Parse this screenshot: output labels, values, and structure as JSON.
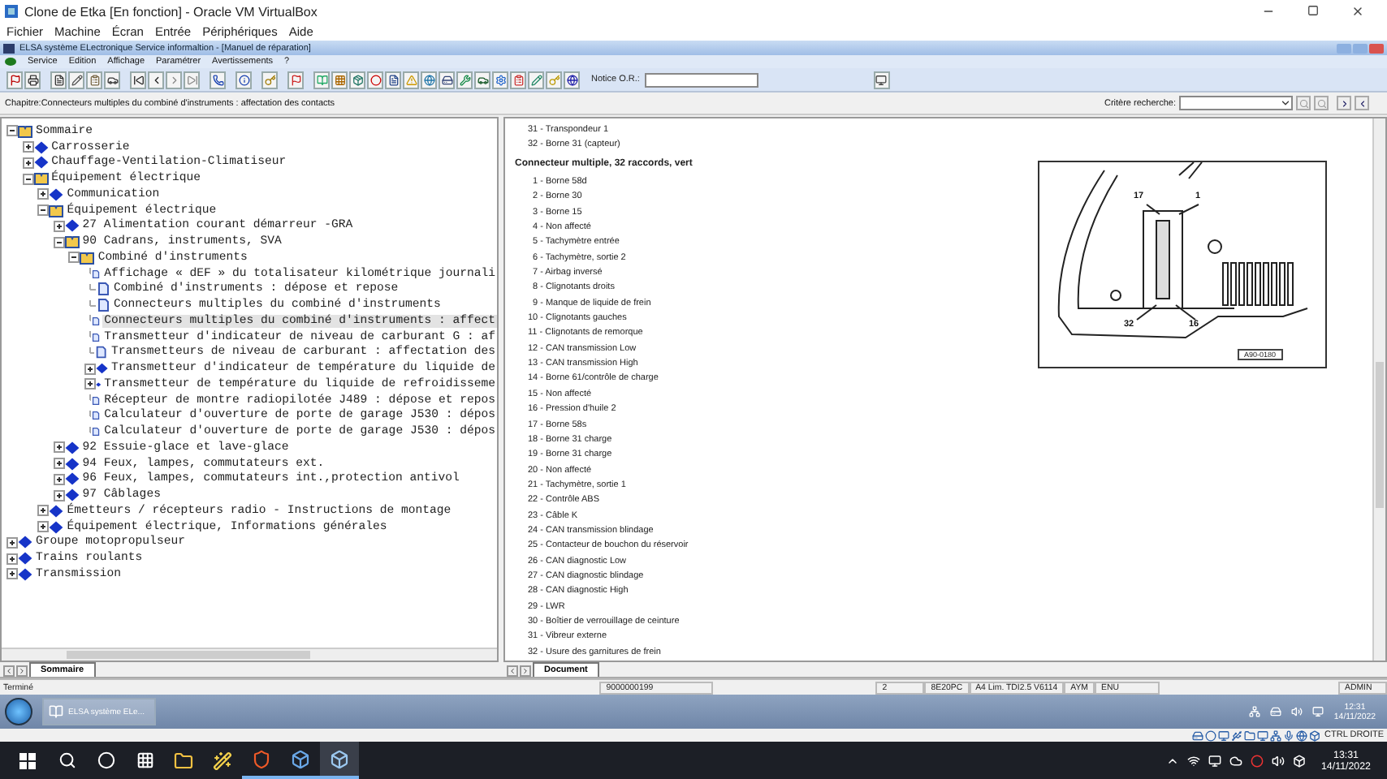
{
  "vbox": {
    "title": "Clone de Etka [En fonction] - Oracle VM VirtualBox",
    "menu": [
      "Fichier",
      "Machine",
      "Écran",
      "Entrée",
      "Périphériques",
      "Aide"
    ],
    "host_key": "CTRL DROITE"
  },
  "app": {
    "title": "ELSA système ELectronique Service informaltion - [Manuel de réparation]",
    "menu": [
      "Service",
      "Edition",
      "Affichage",
      "Paramétrer",
      "Avertissements",
      "?"
    ],
    "notice_label": "Notice O.R.:",
    "chapter": "Chapitre:Connecteurs multiples du combiné d'instruments : affectation des contacts",
    "search_label": "Critère recherche:"
  },
  "tree": {
    "items": [
      {
        "label": "Sommaire",
        "kind": "folder",
        "expanded": true,
        "selected": false,
        "children": [
          {
            "label": "Carrosserie",
            "kind": "topic",
            "expanded": false,
            "selected": false
          },
          {
            "label": "Chauffage-Ventilation-Climatiseur",
            "kind": "topic",
            "expanded": false,
            "selected": false
          },
          {
            "label": "Équipement électrique",
            "kind": "folder",
            "expanded": true,
            "selected": false,
            "children": [
              {
                "label": "Communication",
                "kind": "topic",
                "expanded": false,
                "selected": false
              },
              {
                "label": "Équipement électrique",
                "kind": "folder",
                "expanded": true,
                "selected": false,
                "children": [
                  {
                    "label": "27 Alimentation courant démarreur -GRA",
                    "kind": "topic",
                    "expanded": false,
                    "selected": false
                  },
                  {
                    "label": "90 Cadrans, instruments, SVA",
                    "kind": "folder",
                    "expanded": true,
                    "selected": false,
                    "children": [
                      {
                        "label": "Combiné d'instruments",
                        "kind": "folder",
                        "expanded": true,
                        "selected": false,
                        "children": [
                          {
                            "label": "Affichage « dEF » du totalisateur kilométrique journali",
                            "kind": "page",
                            "selected": false
                          },
                          {
                            "label": "Combiné d'instruments : dépose et repose",
                            "kind": "page",
                            "selected": false
                          },
                          {
                            "label": "Connecteurs multiples du combiné d'instruments",
                            "kind": "page",
                            "selected": false
                          },
                          {
                            "label": "Connecteurs multiples du combiné d'instruments : affect",
                            "kind": "page",
                            "selected": true
                          },
                          {
                            "label": "Transmetteur d'indicateur de niveau de carburant G : af",
                            "kind": "page",
                            "selected": false
                          },
                          {
                            "label": "Transmetteurs de niveau de carburant : affectation des",
                            "kind": "page",
                            "selected": false
                          },
                          {
                            "label": "Transmetteur d'indicateur de température du liquide de",
                            "kind": "topic",
                            "expanded": false,
                            "selected": false
                          },
                          {
                            "label": "Transmetteur de température du liquide de refroidisseme",
                            "kind": "topic",
                            "expanded": false,
                            "selected": false
                          },
                          {
                            "label": "Récepteur de montre radiopilotée J489 : dépose et repos",
                            "kind": "page",
                            "selected": false
                          },
                          {
                            "label": "Calculateur d'ouverture de porte de garage J530 : dépos",
                            "kind": "page",
                            "selected": false
                          },
                          {
                            "label": "Calculateur d'ouverture de porte de garage J530 : dépos",
                            "kind": "page",
                            "selected": false
                          }
                        ]
                      }
                    ]
                  },
                  {
                    "label": "92 Essuie-glace et lave-glace",
                    "kind": "topic",
                    "expanded": false,
                    "selected": false
                  },
                  {
                    "label": "94 Feux, lampes, commutateurs ext.",
                    "kind": "topic",
                    "expanded": false,
                    "selected": false
                  },
                  {
                    "label": "96 Feux, lampes, commutateurs int.,protection antivol",
                    "kind": "topic",
                    "expanded": false,
                    "selected": false
                  },
                  {
                    "label": "97 Câblages",
                    "kind": "topic",
                    "expanded": false,
                    "selected": false
                  }
                ]
              },
              {
                "label": "Émetteurs / récepteurs radio - Instructions de montage",
                "kind": "topic",
                "expanded": false,
                "selected": false
              },
              {
                "label": "Équipement électrique, Informations générales",
                "kind": "topic",
                "expanded": false,
                "selected": false
              }
            ]
          }
        ]
      },
      {
        "label": "Groupe motopropulseur",
        "kind": "topic",
        "expanded": false,
        "selected": false
      },
      {
        "label": "Trains roulants",
        "kind": "topic",
        "expanded": false,
        "selected": false
      },
      {
        "label": "Transmission",
        "kind": "topic",
        "expanded": false,
        "selected": false
      }
    ],
    "tab": {
      "label": "Sommaire",
      "selected": true
    }
  },
  "document": {
    "lines_before": [
      "31 - Transpondeur 1",
      "32 - Borne 31 (capteur)"
    ],
    "heading": "Connecteur multiple, 32 raccords, vert",
    "lines": [
      "1 - Borne 58d",
      "2 - Borne 30",
      "3 - Borne 15",
      "4 - Non affecté",
      "5 - Tachymètre entrée",
      "6 - Tachymètre, sortie 2",
      "7 - Airbag inversé",
      "8 - Clignotants droits",
      "9 - Manque de liquide de frein",
      "10 - Clignotants gauches",
      "11 - Clignotants de remorque",
      "12 - CAN transmission Low",
      "13 - CAN transmission High",
      "14 - Borne 61/contrôle de charge",
      "15 - Non affecté",
      "16 - Pression d'huile 2",
      "17 - Borne 58s",
      "18 - Borne 31 charge",
      "19 - Borne 31 charge",
      "20 - Non affecté",
      "21 - Tachymètre, sortie 1",
      "22 - Contrôle ABS",
      "23 - Câble K",
      "24 - CAN transmission blindage",
      "25 - Contacteur de bouchon du réservoir",
      "26 - CAN diagnostic Low",
      "27 - CAN diagnostic blindage",
      "28 - CAN diagnostic High",
      "29 - LWR",
      "30 - Boîtier de verrouillage de ceinture",
      "31 - Vibreur externe",
      "32 - Usure des garnitures de frein"
    ],
    "figure": {
      "labels": [
        "17",
        "1",
        "32",
        "16"
      ],
      "code": "A90-0180"
    },
    "tab": {
      "label": "Document",
      "selected": true
    }
  },
  "status_bar": {
    "message": "Terminé",
    "fields": [
      "9000000199",
      "2",
      "8E20PC",
      "A4 Lim. TDI2.5 V6114",
      "AYM",
      "ENU",
      "ADMIN"
    ]
  },
  "guest_taskbar": {
    "task": "ELSA système ELe...",
    "time": "12:31",
    "date": "14/11/2022"
  },
  "host_taskbar": {
    "time": "13:31",
    "date": "14/11/2022"
  }
}
